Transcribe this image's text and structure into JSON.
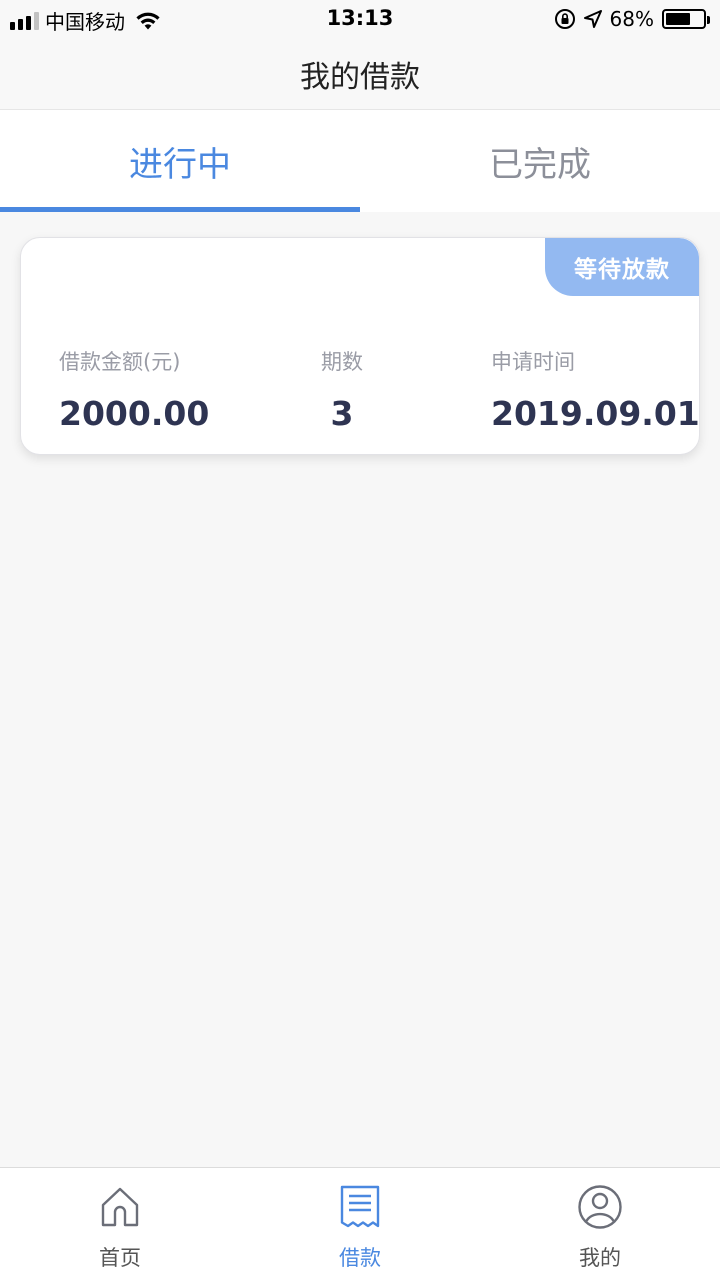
{
  "status_bar": {
    "carrier": "中国移动",
    "time": "13:13",
    "battery": "68%",
    "battery_level": 0.68
  },
  "header": {
    "title": "我的借款"
  },
  "tabs": [
    {
      "label": "进行中",
      "active": true
    },
    {
      "label": "已完成",
      "active": false
    }
  ],
  "loan": {
    "status": "等待放款",
    "amount_label": "借款金额(元)",
    "amount": "2000.00",
    "terms_label": "期数",
    "terms": "3",
    "date_label": "申请时间",
    "date": "2019.09.01"
  },
  "bottom_nav": [
    {
      "label": "首页",
      "icon": "home-icon",
      "active": false
    },
    {
      "label": "借款",
      "icon": "receipt-icon",
      "active": true
    },
    {
      "label": "我的",
      "icon": "user-icon",
      "active": false
    }
  ],
  "colors": {
    "accent": "#4a88e0",
    "badge": "#93b9f1",
    "value_text": "#2e3452",
    "label_text": "#9a9ca6"
  }
}
